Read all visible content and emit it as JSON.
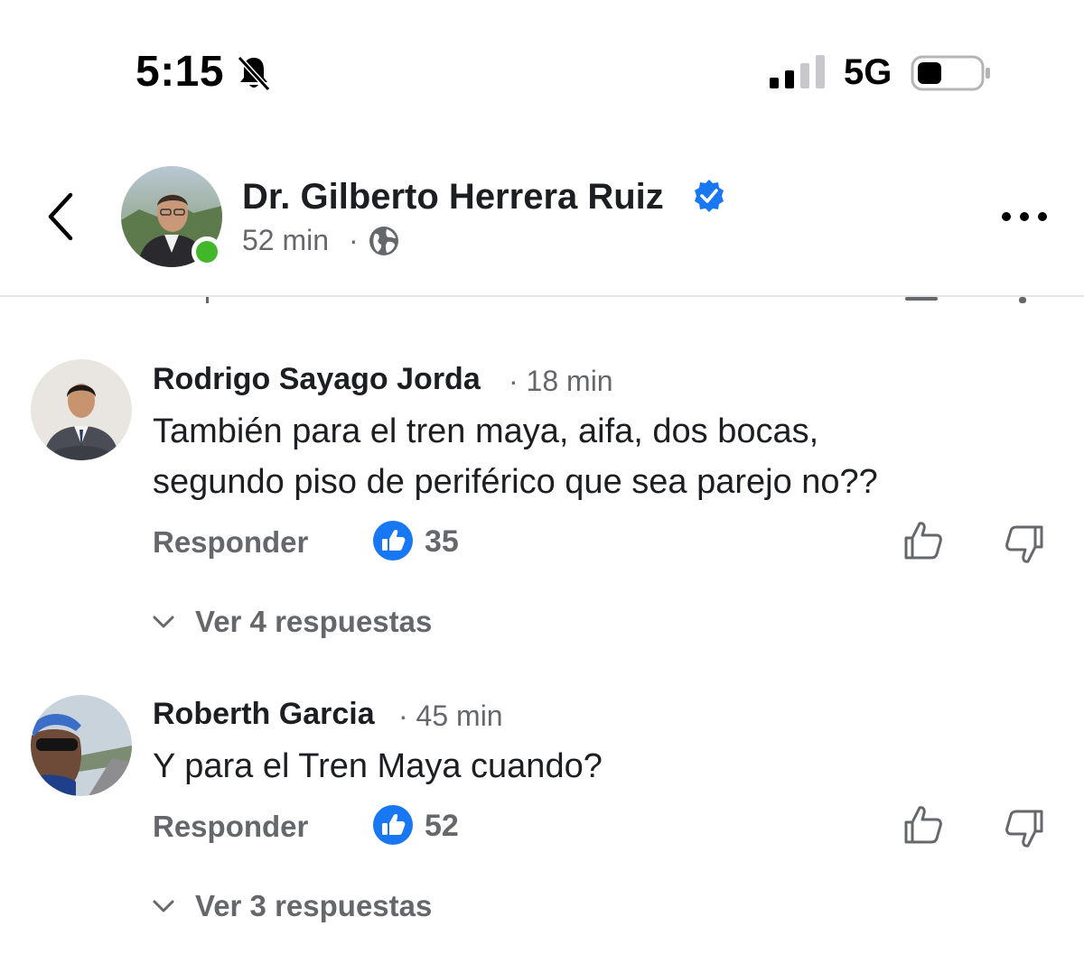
{
  "status_bar": {
    "time": "5:15",
    "network": "5G",
    "icons": [
      "bell-slash-icon",
      "signal-icon",
      "battery-icon"
    ]
  },
  "header": {
    "page_name": "Dr. Gilberto Herrera Ruiz",
    "post_time": "52 min",
    "separator": "·",
    "icons": [
      "back-chevron-icon",
      "verified-badge-icon",
      "globe-icon",
      "more-options-icon"
    ]
  },
  "comments": [
    {
      "author": "Rodrigo Sayago Jorda",
      "time": "· 18 min",
      "text_lines": [
        "También para el tren maya, aifa, dos bocas,",
        "segundo piso de periférico que sea parejo no??"
      ],
      "reply_label": "Responder",
      "like_count": "35",
      "replies_label": "Ver 4 respuestas"
    },
    {
      "author": "Roberth Garcia",
      "time": "· 45 min",
      "text_lines": [
        "Y para el Tren Maya cuando?"
      ],
      "reply_label": "Responder",
      "like_count": "52",
      "replies_label": "Ver 3 respuestas"
    }
  ],
  "colors": {
    "text": "#1c1e21",
    "secondary": "#65676b",
    "facebook_blue": "#1877f2",
    "online_green": "#42b72a"
  }
}
